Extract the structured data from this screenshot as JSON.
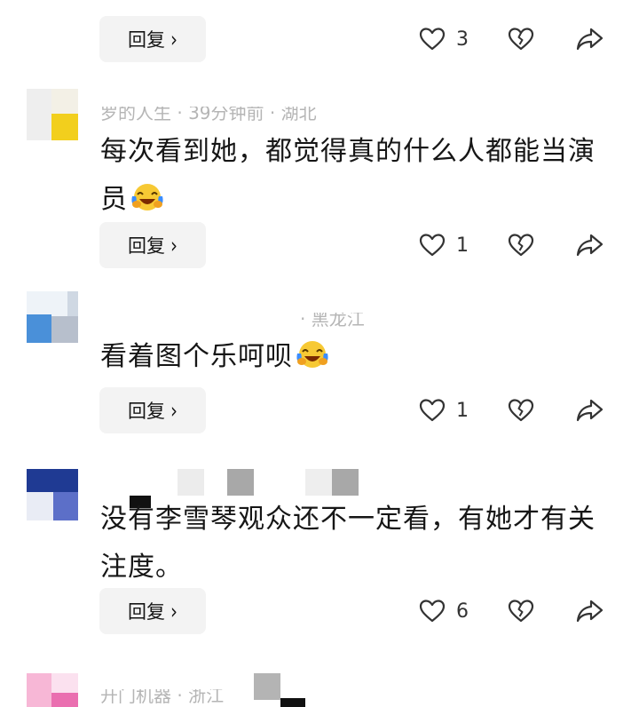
{
  "reply_label": "回复",
  "chevron": "›",
  "icons": {
    "like": "heart-outline-icon",
    "dislike": "broken-heart-icon",
    "share": "share-arrow-icon",
    "emoji": "laughing-crying-emoji",
    "reply_chevron": "chevron-right-icon"
  },
  "colors": {
    "text": "#161616",
    "meta": "#b5b5b5",
    "reply_bg": "#f3f3f3",
    "icon": "#333333",
    "emoji_face": "#f7c934",
    "emoji_tear": "#3b8dff"
  },
  "comments": [
    {
      "text": "",
      "likes": "3"
    },
    {
      "meta": "罗的人生 · 39分钟前 · 湖北",
      "text": "每次看到她，都觉得真的什么人都能当演员",
      "likes": "1"
    },
    {
      "meta": "· 黑龙江",
      "text": "看着图个乐呵呗",
      "likes": "1"
    },
    {
      "meta": "",
      "text": "没有李雪琴观众还不一定看，有她才有关注度。",
      "likes": "6"
    },
    {
      "meta": "开门机器 · 浙江",
      "text": ""
    }
  ]
}
